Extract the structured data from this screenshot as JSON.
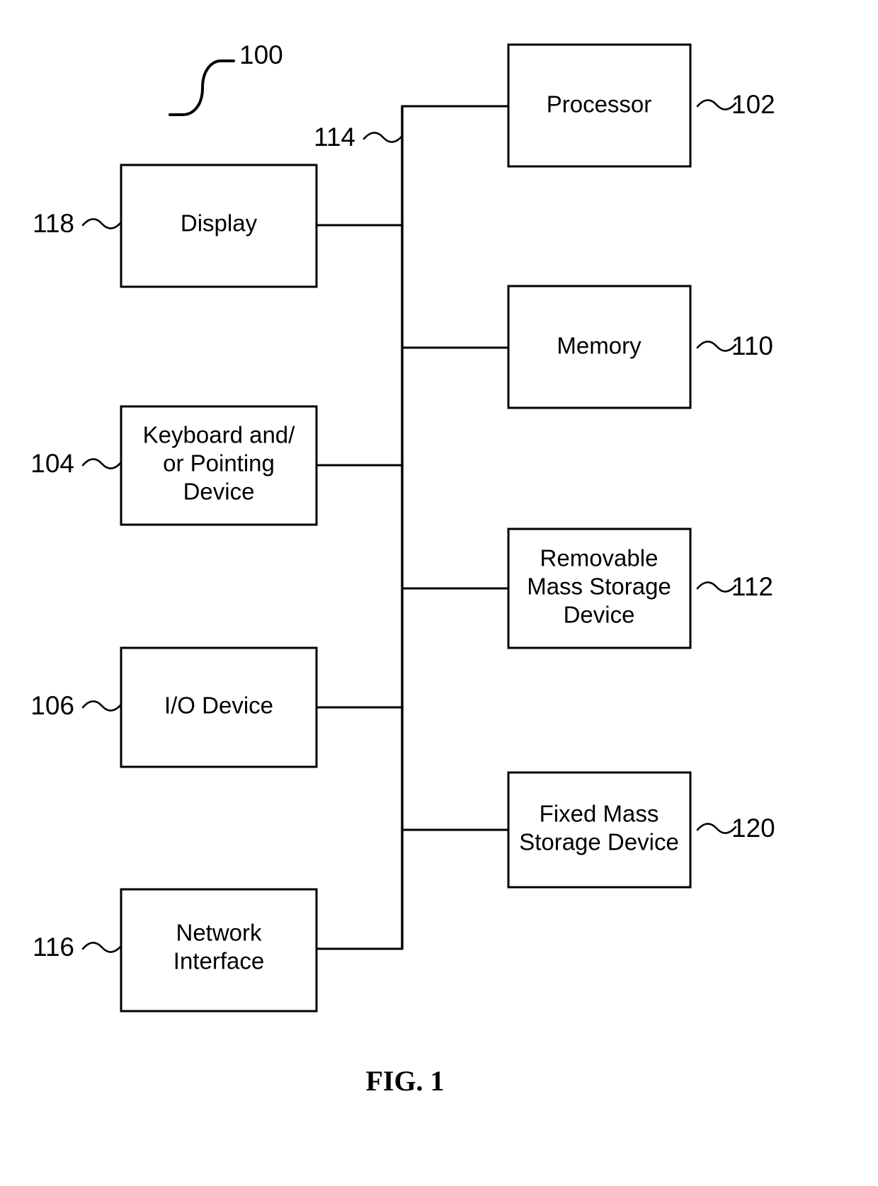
{
  "figure": {
    "caption": "FIG. 1",
    "system_ref": "100",
    "bus_ref": "114"
  },
  "blocks": {
    "processor": {
      "label": "Processor",
      "ref": "102"
    },
    "memory": {
      "label": "Memory",
      "ref": "110"
    },
    "removable": {
      "line1": "Removable",
      "line2": "Mass Storage",
      "line3": "Device",
      "ref": "112"
    },
    "fixed": {
      "line1": "Fixed Mass",
      "line2": "Storage Device",
      "ref": "120"
    },
    "display": {
      "label": "Display",
      "ref": "118"
    },
    "keyboard": {
      "line1": "Keyboard and/",
      "line2": "or Pointing",
      "line3": "Device",
      "ref": "104"
    },
    "io": {
      "label": "I/O Device",
      "ref": "106"
    },
    "network": {
      "line1": "Network",
      "line2": "Interface",
      "ref": "116"
    }
  },
  "colors": {
    "stroke": "#000000",
    "background": "#ffffff"
  }
}
